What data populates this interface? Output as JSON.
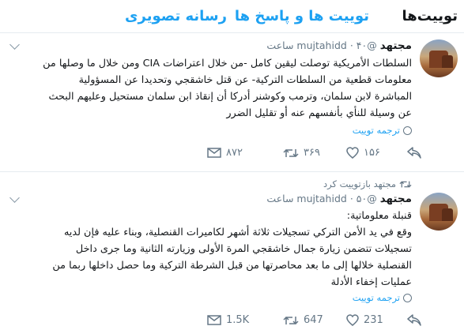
{
  "tabs": {
    "tweets": "توییت‌ها",
    "tweets_replies": "توییت ها و پاسخ ها",
    "media": "رسانه تصویری"
  },
  "tweets": [
    {
      "name": "مجتهد",
      "handle": "@mujtahidd",
      "time": "۴۰ ساعت",
      "lines": [
        "السلطات الأمريكية توصلت ليقين كامل -من خلال اعتراضات CIA ومن خلال ما وصلها من",
        "معلومات قطعية من السلطات التركية- عن قتل خاشقجي وتحديدا عن المسؤولية",
        "المباشرة لابن سلمان، وترمب وكوشنر أدركا أن إنقاذ ابن سلمان مستحيل وعليهم البحث",
        "عن وسيلة للنأي بأنفسهم عنه أو تقليل الضرر"
      ],
      "translate": "ترجمه توییت",
      "replies": "",
      "retweets": "۳۶۹",
      "likes": "۱۵۶",
      "messages": "۸۷۲"
    },
    {
      "retweeted_by": "مجتهد بازتوییت کرد",
      "name": "مجتهد",
      "handle": "@mujtahidd",
      "time": "۵۰ ساعت",
      "lines": [
        "قنبلة معلوماتية:",
        "وقع في يد الأمن التركي تسجيلات ثلاثة أشهر لكاميرات القنصلية، وبناء عليه فإن لديه",
        "تسجيلات تتضمن زيارة جمال خاشقجي المرة الأولى وزيارته الثانية وما جرى داخل",
        "القنصلية خلالها إلى ما بعد محاصرتها من قبل الشرطة التركية وما حصل داخلها ربما من",
        "عمليات إخفاء الأدلة"
      ],
      "translate": "ترجمه توییت",
      "replies": "",
      "retweets": "647",
      "likes": "231",
      "messages": "1.5K"
    }
  ],
  "colors": {
    "accent": "#1da1f2",
    "muted": "#657786",
    "text": "#14171a",
    "divider": "#e6ecf0"
  },
  "icons": [
    "reply-icon",
    "retweet-icon",
    "like-icon",
    "message-icon",
    "globe-icon",
    "chevron-down-icon"
  ]
}
